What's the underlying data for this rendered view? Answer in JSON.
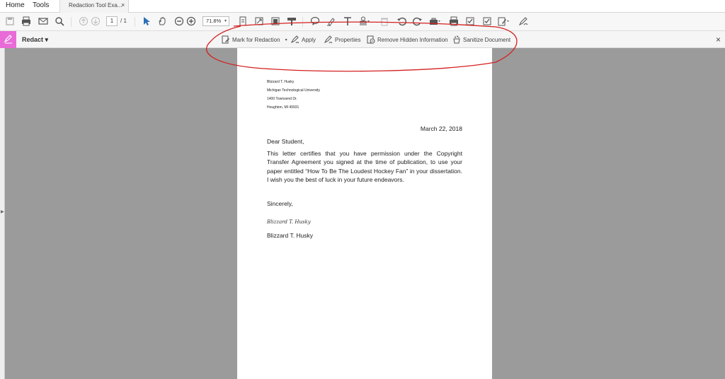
{
  "tabs": {
    "home": "Home",
    "tools": "Tools",
    "document": "Redaction Tool Exa...",
    "close": "×"
  },
  "toolbar": {
    "page_current": "1",
    "page_total": "/ 1",
    "zoom": "71.8%",
    "icons": [
      "save-icon",
      "print-icon",
      "email-icon",
      "search-icon",
      "prev-page-icon",
      "next-page-icon",
      "select-arrow-icon",
      "hand-icon",
      "zoom-out-icon",
      "zoom-in-icon",
      "fit-page-icon",
      "fit-width-icon",
      "full-screen-icon",
      "comment-icon",
      "highlighter-icon",
      "text-icon",
      "stamp-icon",
      "trash-icon",
      "undo-icon",
      "redo-icon",
      "toolbox-icon",
      "print2-icon",
      "checkbox-icon",
      "checkbox2-icon",
      "sign-icon",
      "pen-icon"
    ]
  },
  "redact": {
    "title": "Redact ▾",
    "mark": "Mark for Redaction",
    "apply": "Apply",
    "properties": "Properties",
    "remove_hidden": "Remove Hidden Information",
    "sanitize": "Sanitize Document",
    "close": "×"
  },
  "letter": {
    "address": [
      "Blizzard T. Husky",
      "Michigan Technological University",
      "1400 Townsend Dr.",
      "Houghton, MI 49931"
    ],
    "date": "March 22, 2018",
    "greeting": "Dear Student,",
    "body": "This letter certifies that you have permission under the Copyright Transfer Agreement you signed at the time of publication, to use your paper entitled “How To Be The Loudest Hockey Fan” in your dissertation. I wish you the best of luck in your future endeavors.",
    "closing": "Sincerely,",
    "signature": "Blizzard T. Husky",
    "signer": "Blizzard T. Husky"
  },
  "colors": {
    "redact_accent": "#e96bd8",
    "annotation": "#d42020",
    "canvas_bg": "#9b9b9b"
  }
}
